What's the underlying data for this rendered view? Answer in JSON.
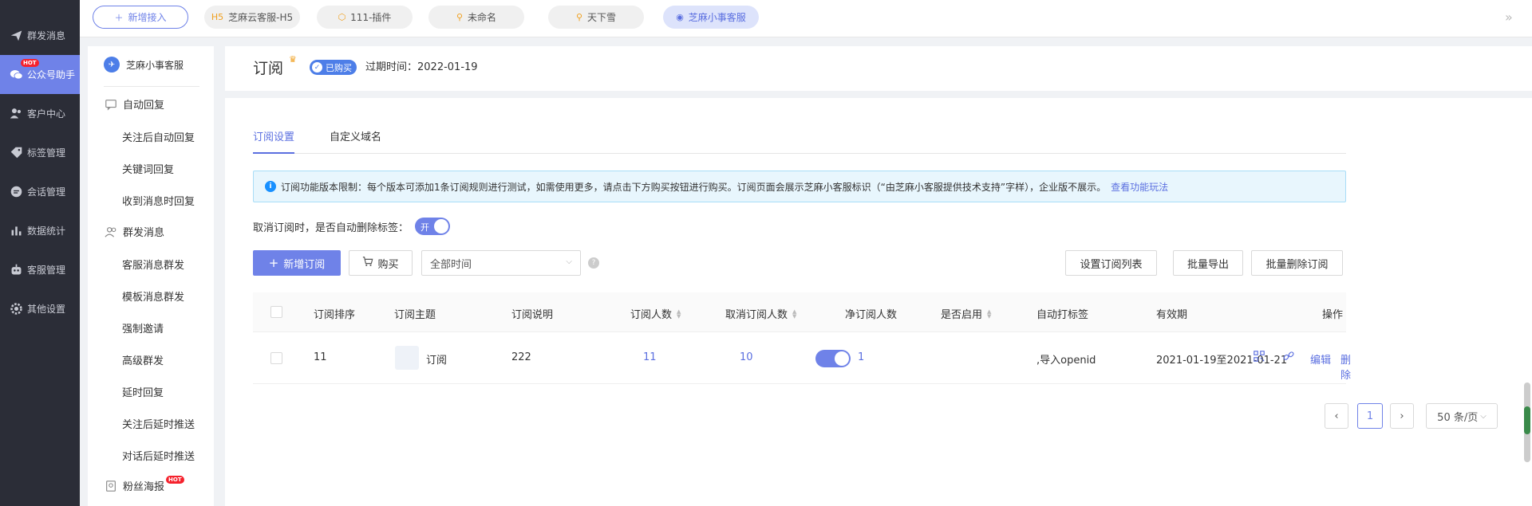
{
  "left_nav": {
    "items": [
      {
        "label": "群发消息",
        "icon": "send-icon"
      },
      {
        "label": "公众号助手",
        "icon": "wechat-icon",
        "badge": "HOT"
      },
      {
        "label": "客户中心",
        "icon": "users-icon"
      },
      {
        "label": "标签管理",
        "icon": "tag-icon"
      },
      {
        "label": "会话管理",
        "icon": "chat-icon"
      },
      {
        "label": "数据统计",
        "icon": "bar-chart-icon"
      },
      {
        "label": "客服管理",
        "icon": "robot-icon"
      },
      {
        "label": "其他设置",
        "icon": "gear-icon"
      }
    ]
  },
  "top_tabs": {
    "new_label": "新增接入",
    "tabs": [
      {
        "prefix": "H5",
        "label": "芝麻云客服-H5"
      },
      {
        "prefix": "⬡",
        "label": "111-插件"
      },
      {
        "prefix": "⚲",
        "label": "未命名"
      },
      {
        "prefix": "⚲",
        "label": "天下雪"
      },
      {
        "prefix": "◉",
        "label": "芝麻小事客服"
      }
    ]
  },
  "side_menu": {
    "account": "芝麻小事客服",
    "groups": [
      {
        "label": "自动回复",
        "items": [
          "关注后自动回复",
          "关键词回复",
          "收到消息时回复"
        ]
      },
      {
        "label": "群发消息",
        "items": [
          "客服消息群发",
          "模板消息群发",
          "强制邀请",
          "高级群发",
          "延时回复",
          "关注后延时推送",
          "对话后延时推送"
        ]
      }
    ],
    "extra": {
      "label": "粉丝海报",
      "badge": "HOT"
    }
  },
  "header": {
    "title": "订阅",
    "badge": "已购买",
    "expire": "过期时间：2022-01-19"
  },
  "main": {
    "tabs": [
      "订阅设置",
      "自定义域名"
    ],
    "notice": "订阅功能版本限制：每个版本可添加1条订阅规则进行测试，如需使用更多，请点击下方购买按钮进行购买。订阅页面会展示芝麻小客服标识（“由芝麻小客服提供技术支持”字样），企业版不展示。",
    "notice_link": "查看功能玩法",
    "toggle_label": "取消订阅时，是否自动删除标签：",
    "toggle_text": "开",
    "toolbar": {
      "add": "新增订阅",
      "buy": "购买",
      "time_select": "全部时间",
      "set_list": "设置订阅列表",
      "export": "批量导出",
      "batch_delete": "批量删除订阅"
    },
    "table": {
      "headers": [
        "订阅排序",
        "订阅主题",
        "订阅说明",
        "订阅人数",
        "取消订阅人数",
        "净订阅人数",
        "是否启用",
        "自动打标签",
        "有效期",
        "操作"
      ],
      "rows": [
        {
          "order": "11",
          "topic": "订阅",
          "desc": "222",
          "subs": "11",
          "cancel": "10",
          "net": "1",
          "enabled": true,
          "tag": ",导入openid",
          "period": "2021-01-19至2021-01-21",
          "edit": "编辑",
          "delete": "删除"
        }
      ]
    },
    "pagination": {
      "page": "1",
      "page_size": "50 条/页"
    }
  }
}
